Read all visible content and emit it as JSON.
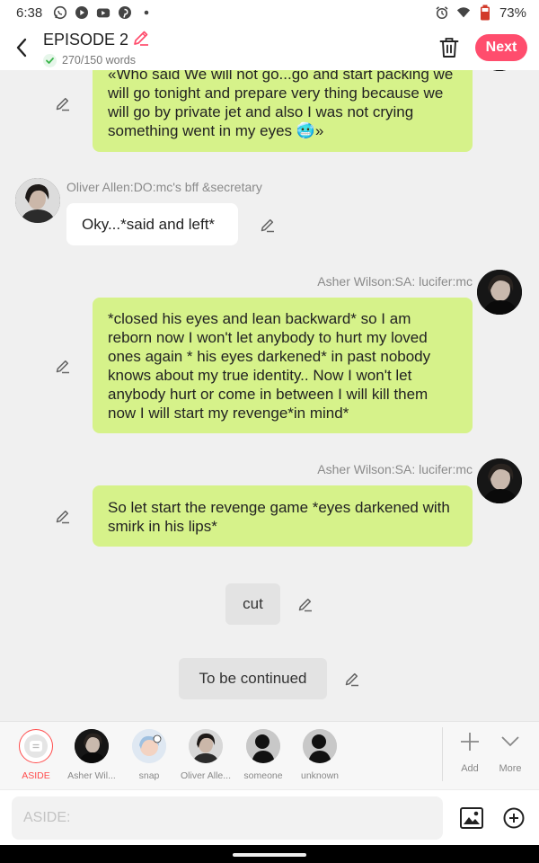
{
  "status_bar": {
    "time": "6:38",
    "battery": "73%",
    "icons": [
      "whatsapp-icon",
      "play-icon",
      "youtube-icon",
      "pinterest-icon",
      "dot-icon",
      "alarm-icon",
      "wifi-icon",
      "battery-icon"
    ]
  },
  "header": {
    "title": "EPISODE 2",
    "word_count": "270/150 words",
    "next_label": "Next",
    "accent": "#ff4d6d"
  },
  "messages": [
    {
      "type": "outgoing",
      "text": "«Who said We will not go...go and start packing we will go tonight and prepare very thing because we will go by private jet and also I was not crying something went in my eyes 🥶»"
    },
    {
      "type": "incoming",
      "sender": "Oliver Allen:DO:mc's bff &secretary",
      "text": "Oky...*said and left*"
    },
    {
      "type": "outgoing",
      "sender": "Asher Wilson:SA: lucifer:mc",
      "text": "*closed his eyes and lean backward* so I am reborn now I won't let anybody to hurt my loved ones again * his eyes darkened* in past nobody knows about my true identity.. Now I won't let anybody hurt or come in between I will kill them now I will start my revenge*in mind*"
    },
    {
      "type": "outgoing",
      "sender": "Asher Wilson:SA: lucifer:mc",
      "text": "So let start the revenge game *eyes darkened with smirk in his lips*"
    },
    {
      "type": "aside",
      "text": "cut"
    },
    {
      "type": "aside",
      "text": "To be continued"
    }
  ],
  "characters": [
    {
      "name": "ASIDE",
      "selected": true
    },
    {
      "name": "Asher Wil..."
    },
    {
      "name": "snap"
    },
    {
      "name": "Oliver Alle..."
    },
    {
      "name": "someone"
    },
    {
      "name": "unknown"
    }
  ],
  "tray_actions": {
    "add": "Add",
    "more": "More"
  },
  "input": {
    "placeholder": "ASIDE:"
  },
  "colors": {
    "bubble_green": "#d6f28a",
    "selected_red": "#ff4d4d"
  }
}
